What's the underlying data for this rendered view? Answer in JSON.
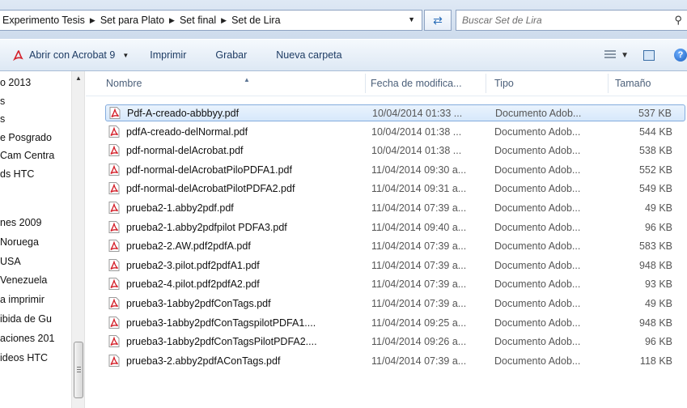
{
  "address_bar": {
    "breadcrumbs": [
      "Experimento Tesis",
      "Set para Plato",
      "Set final",
      "Set de Lira"
    ],
    "search_placeholder": "Buscar Set de Lira"
  },
  "toolbar": {
    "open_with": "Abrir con Acrobat 9",
    "print": "Imprimir",
    "burn": "Grabar",
    "new_folder": "Nueva carpeta"
  },
  "nav_pane": {
    "items": [
      "o 2013",
      "s",
      "s",
      "e Posgrado",
      "Cam Centra",
      "ds HTC",
      "",
      "nes 2009",
      "Noruega",
      "USA",
      "Venezuela",
      "a imprimir",
      "ibida de Gu",
      "aciones 201",
      "ideos HTC"
    ]
  },
  "columns": {
    "name": "Nombre",
    "date": "Fecha de modifica...",
    "type": "Tipo",
    "size": "Tamaño"
  },
  "files": [
    {
      "name": "Pdf-A-creado-abbbyy.pdf",
      "date": "10/04/2014 01:33 ...",
      "type": "Documento Adob...",
      "size": "537 KB"
    },
    {
      "name": "pdfA-creado-delNormal.pdf",
      "date": "10/04/2014 01:38 ...",
      "type": "Documento Adob...",
      "size": "544 KB"
    },
    {
      "name": "pdf-normal-delAcrobat.pdf",
      "date": "10/04/2014 01:38 ...",
      "type": "Documento Adob...",
      "size": "538 KB"
    },
    {
      "name": "pdf-normal-delAcrobatPiloPDFA1.pdf",
      "date": "11/04/2014 09:30 a...",
      "type": "Documento Adob...",
      "size": "552 KB"
    },
    {
      "name": "pdf-normal-delAcrobatPilotPDFA2.pdf",
      "date": "11/04/2014 09:31 a...",
      "type": "Documento Adob...",
      "size": "549 KB"
    },
    {
      "name": "prueba2-1.abby2pdf.pdf",
      "date": "11/04/2014 07:39 a...",
      "type": "Documento Adob...",
      "size": "49 KB"
    },
    {
      "name": "prueba2-1.abby2pdfpilot PDFA3.pdf",
      "date": "11/04/2014 09:40 a...",
      "type": "Documento Adob...",
      "size": "96 KB"
    },
    {
      "name": "prueba2-2.AW.pdf2pdfA.pdf",
      "date": "11/04/2014 07:39 a...",
      "type": "Documento Adob...",
      "size": "583 KB"
    },
    {
      "name": "prueba2-3.pilot.pdf2pdfA1.pdf",
      "date": "11/04/2014 07:39 a...",
      "type": "Documento Adob...",
      "size": "948 KB"
    },
    {
      "name": "prueba2-4.pilot.pdf2pdfA2.pdf",
      "date": "11/04/2014 07:39 a...",
      "type": "Documento Adob...",
      "size": "93 KB"
    },
    {
      "name": "prueba3-1abby2pdfConTags.pdf",
      "date": "11/04/2014 07:39 a...",
      "type": "Documento Adob...",
      "size": "49 KB"
    },
    {
      "name": "prueba3-1abby2pdfConTagspilotPDFA1....",
      "date": "11/04/2014 09:25 a...",
      "type": "Documento Adob...",
      "size": "948 KB"
    },
    {
      "name": "prueba3-1abby2pdfConTagsPilotPDFA2....",
      "date": "11/04/2014 09:26 a...",
      "type": "Documento Adob...",
      "size": "96 KB"
    },
    {
      "name": "prueba3-2.abby2pdfAConTags.pdf",
      "date": "11/04/2014 07:39 a...",
      "type": "Documento Adob...",
      "size": "118 KB"
    }
  ],
  "selected_index": 0,
  "icons": {
    "pdf": "pdf-file-icon",
    "refresh": "refresh-icon",
    "search": "search-icon",
    "views": "views-icon",
    "preview_pane": "preview-pane-icon",
    "help": "help-icon"
  },
  "colors": {
    "selection": "#d7e8fb",
    "selection_border": "#84acdd",
    "pdf_red": "#d4202a"
  }
}
